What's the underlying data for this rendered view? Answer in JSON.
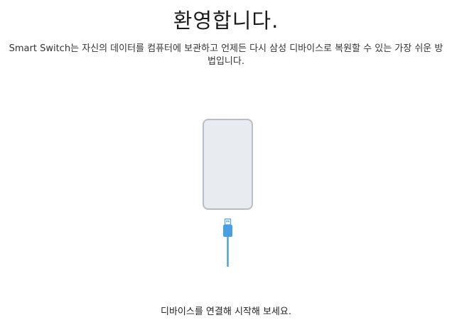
{
  "welcome": {
    "title": "환영합니다.",
    "description": "Smart Switch는 자신의 데이터를 컴퓨터에 보관하고 언제든 다시 삼성 디바이스로 복원할 수 있는 가장 쉬운 방법입니다."
  },
  "illustration": {
    "phone_icon": "phone-icon",
    "cable_icon": "usb-cable-icon",
    "phone_color": "#e8ebef",
    "phone_border": "#b9bec4",
    "cable_color": "#4a9fe0"
  },
  "status": {
    "hint": "디바이스를 연결해 시작해 보세요."
  }
}
